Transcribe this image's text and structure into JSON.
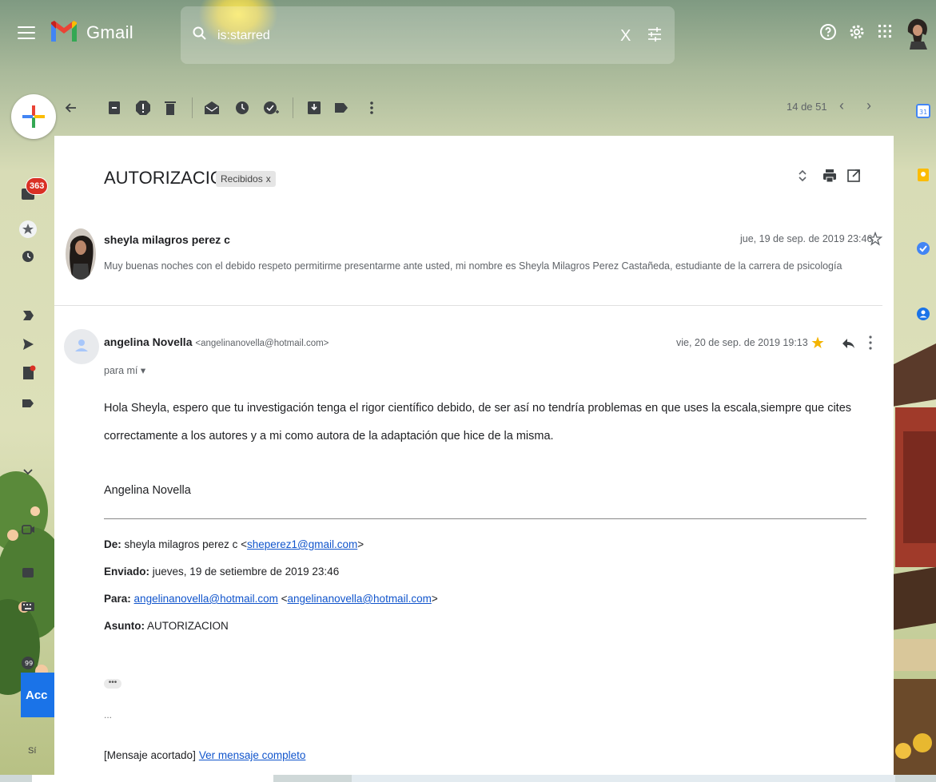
{
  "app": {
    "name": "Gmail"
  },
  "search": {
    "query": "is:starred",
    "clear_label": "X"
  },
  "nav": {
    "inbox_badge": "363",
    "accept_label": "Acc",
    "accept_sub": "Sí"
  },
  "toolbar": {
    "pager_text": "14 de 51",
    "prev": "‹",
    "next": "›"
  },
  "thread": {
    "subject": "AUTORIZACION",
    "label": "Recibidos",
    "label_remove": "x"
  },
  "message1": {
    "sender": "sheyla milagros perez c",
    "date": "jue, 19 de sep. de 2019 23:46",
    "snippet": "Muy buenas noches con el debido respeto permitirme presentarme ante usted, mi nombre es Sheyla Milagros Perez Castañeda, estudiante de la carrera de psicología"
  },
  "message2": {
    "sender": "angelina Novella",
    "sender_email": "<angelinanovella@hotmail.com>",
    "to": "para mí",
    "date": "vie, 20 de sep. de 2019 19:13",
    "body": "Hola Sheyla, espero que tu investigación tenga el rigor científico debido, de ser así no tendría problemas en que uses la escala,siempre que cites correctamente a los autores y a mi como autora de la adaptación que hice de la misma.",
    "signature": "Angelina Novella",
    "forward": {
      "de_label": "De:",
      "de_name": "sheyla milagros perez c <",
      "de_email": "sheperez1@gmail.com",
      "de_close": ">",
      "enviado_label": "Enviado:",
      "enviado_value": "jueves, 19 de setiembre de 2019 23:46",
      "para_label": "Para:",
      "para_email1": "angelinanovella@hotmail.com",
      "para_lt": "<",
      "para_email2": "angelinanovella@hotmail.com",
      "para_gt": ">",
      "asunto_label": "Asunto:",
      "asunto_value": "AUTORIZACION"
    },
    "dots": "•••",
    "ellipsis": "...",
    "truncated": "[Mensaje acortado]",
    "view_full": "Ver mensaje completo"
  },
  "colors": {
    "star": "#f4b400",
    "link": "#1155cc",
    "accent": "#1a73e8",
    "badge": "#d93025"
  }
}
